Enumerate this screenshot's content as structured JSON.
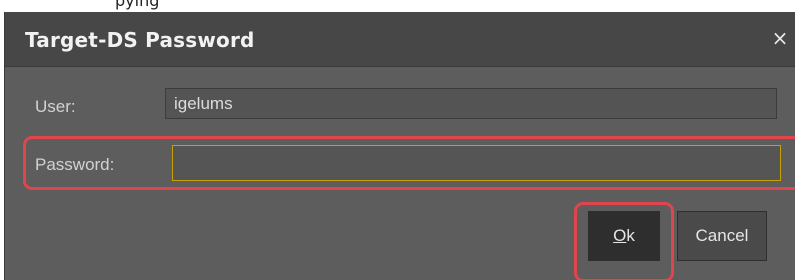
{
  "background": {
    "partial_text": "pying"
  },
  "dialog": {
    "title": "Target-DS Password",
    "close_symbol": "×",
    "close_icon": "close-icon"
  },
  "form": {
    "user_label": "User:",
    "user_value": "igelums",
    "password_label": "Password:",
    "password_value": ""
  },
  "buttons": {
    "ok_mnemonic": "O",
    "ok_rest": "k",
    "cancel_label": "Cancel"
  },
  "colors": {
    "dialog_bg": "#5d5d5d",
    "titlebar_bg": "#474747",
    "highlight": "#e0454d",
    "focus_border": "#c8a000"
  }
}
